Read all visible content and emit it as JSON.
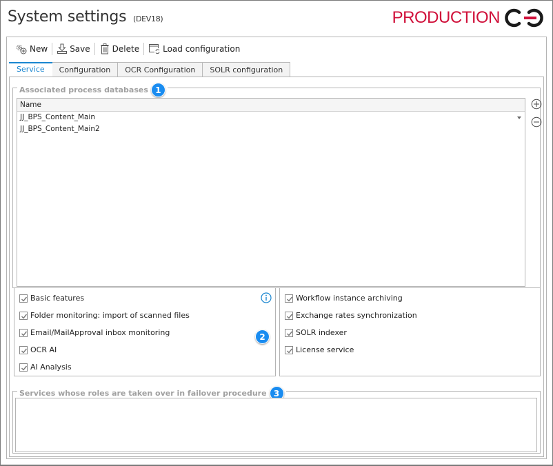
{
  "window": {
    "title": "System settings",
    "subtitle": "(DEV18)",
    "environment_label": "PRODUCTION",
    "environment_color": "#d0103a",
    "accent_color": "#1a86d0"
  },
  "toolbar": {
    "new_label": "New",
    "save_label": "Save",
    "delete_label": "Delete",
    "load_label": "Load configuration"
  },
  "tabs": [
    {
      "label": "Service",
      "active": true
    },
    {
      "label": "Configuration",
      "active": false
    },
    {
      "label": "OCR Configuration",
      "active": false
    },
    {
      "label": "SOLR configuration",
      "active": false
    }
  ],
  "databases": {
    "title": "Associated process databases",
    "badge": "1",
    "column_header": "Name",
    "rows": [
      "JJ_BPS_Content_Main",
      "JJ_BPS_Content_Main2"
    ]
  },
  "services": {
    "badge": "2",
    "left": [
      {
        "label": "Basic features",
        "checked": true
      },
      {
        "label": "Folder monitoring: import of scanned files",
        "checked": true
      },
      {
        "label": "Email/MailApproval inbox monitoring",
        "checked": true
      },
      {
        "label": "OCR AI",
        "checked": true
      },
      {
        "label": "AI Analysis",
        "checked": true
      }
    ],
    "right": [
      {
        "label": "Workflow instance archiving",
        "checked": true
      },
      {
        "label": "Exchange rates synchronization",
        "checked": true
      },
      {
        "label": "SOLR indexer",
        "checked": true
      },
      {
        "label": "License service",
        "checked": true
      }
    ]
  },
  "failover": {
    "title": "Services whose roles are taken over in failover procedure",
    "badge": "3"
  }
}
